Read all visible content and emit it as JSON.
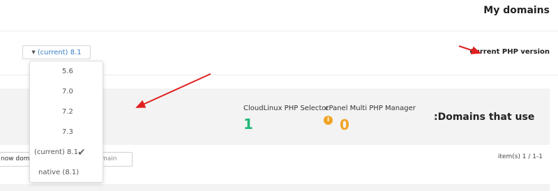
{
  "page": {
    "title": "My domains"
  },
  "php_selector": {
    "current_value": "(current) 8.1",
    "label": "Current PHP version"
  },
  "version_menu": {
    "items": [
      {
        "label": "5.6",
        "selected": false
      },
      {
        "label": "7.0",
        "selected": false
      },
      {
        "label": "7.2",
        "selected": false
      },
      {
        "label": "7.3",
        "selected": false
      },
      {
        "label": "(current) 8.1",
        "selected": true
      },
      {
        "label": "native (8.1)",
        "selected": false
      }
    ]
  },
  "stats": {
    "title": ":Domains that use",
    "cloudlinux": {
      "label": "CloudLinux PHP Selector",
      "count": "1",
      "color": "#1fb876"
    },
    "cpanel": {
      "label": "cPanel Multi PHP Manager",
      "count": "0",
      "color": "#f0a324",
      "info_icon": "i"
    }
  },
  "controls": {
    "show_domains_label": "now doma",
    "search_placeholder": "main",
    "items_count": "item(s) 1 / 1-1"
  },
  "annotations": {
    "arrow_color": "#e02020"
  }
}
